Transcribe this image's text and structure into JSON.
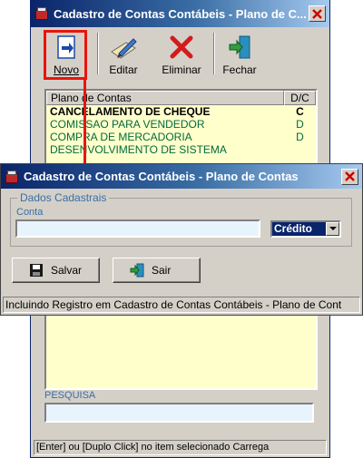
{
  "main_window": {
    "title": "Cadastro de Contas Contábeis - Plano de C...",
    "toolbar": {
      "novo": "Novo",
      "editar": "Editar",
      "eliminar": "Eliminar",
      "fechar": "Fechar"
    },
    "grid": {
      "columns": [
        "Plano de Contas",
        "D/C"
      ],
      "rows": [
        {
          "conta": "CANCELAMENTO DE CHEQUE",
          "dc": "C"
        },
        {
          "conta": "COMISSAO PARA VENDEDOR",
          "dc": "D"
        },
        {
          "conta": "COMPRA DE MERCADORIA",
          "dc": "D"
        },
        {
          "conta": "DESENVOLVIMENTO DE SISTEMA",
          "dc": ""
        }
      ]
    },
    "search": {
      "label": "PESQUISA",
      "value": ""
    },
    "status": "[Enter] ou [Duplo Click] no item selecionado Carrega"
  },
  "dialog": {
    "title": "Cadastro de Contas Contábeis - Plano de Contas",
    "group_label": "Dados Cadastrais",
    "conta_label": "Conta",
    "conta_value": "",
    "dc_selected": "Crédito",
    "salvar": "Salvar",
    "sair": "Sair",
    "status": "Incluindo Registro em Cadastro de Contas Contábeis - Plano de Cont"
  },
  "colors": {
    "titlebar_start": "#0a246a",
    "highlight": "#e8150f",
    "grid_bg": "#ffffcc",
    "grid_text": "#006b3c",
    "label_blue": "#3a6ea5"
  }
}
